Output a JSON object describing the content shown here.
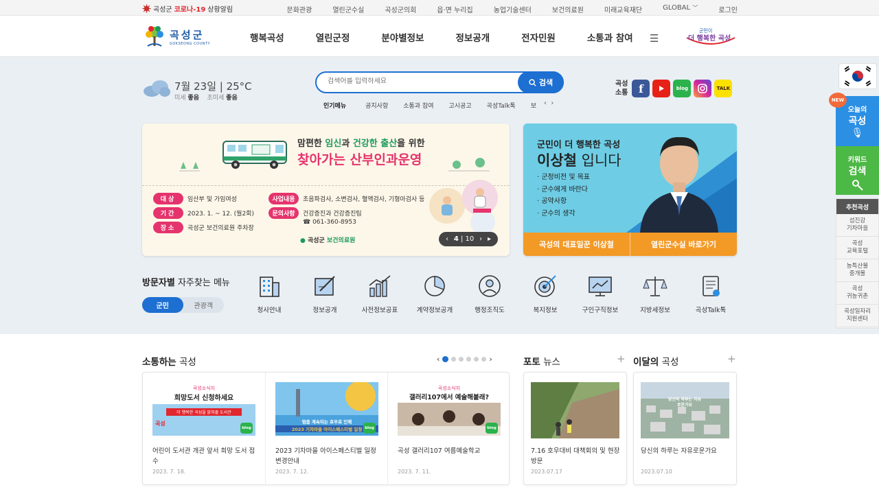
{
  "topbar": {
    "covid_prefix": "곡성군",
    "covid_highlight": "코로나-19",
    "covid_suffix": "상황알림",
    "links": [
      "문화관광",
      "열린군수실",
      "곡성군의회",
      "읍·면 누리집",
      "농업기술센터",
      "보건의료원",
      "미래교육재단",
      "GLOBAL",
      "로그인"
    ]
  },
  "header": {
    "logo_name": "곡성군",
    "logo_en": "GOKSEONG COUNTY",
    "nav": [
      "행복곡성",
      "열린군정",
      "분야별정보",
      "정보공개",
      "전자민원",
      "소통과 참여"
    ],
    "slogan_top": "군민이",
    "slogan_main": "더 행복한 곡성"
  },
  "weather": {
    "date": "7월 23일",
    "temp": "25°C",
    "fine_label": "미세",
    "fine_value": "좋음",
    "ultra_label": "초미세",
    "ultra_value": "좋음"
  },
  "search": {
    "placeholder": "검색어를 입력하세요",
    "button": "검색",
    "popular_label": "인기메뉴",
    "popular": [
      "공지사항",
      "소통과 참여",
      "고시공고",
      "곡성Talk톡",
      "보"
    ]
  },
  "sns": {
    "label_top": "곡성",
    "label_bottom": "소통",
    "icons": [
      "facebook-icon",
      "youtube-icon",
      "blog-icon",
      "instagram-icon",
      "kakaotalk-icon"
    ],
    "blog_text": "blog",
    "talk_text": "TALK"
  },
  "banner": {
    "line1_a": "맘편한 ",
    "line1_b": "임신",
    "line1_c": "과 ",
    "line1_d": "건강한 출산",
    "line1_e": "을 위한",
    "line2": "찾아가는 산부인과운영",
    "rows_left": [
      {
        "label": "대상",
        "text": "임산부 및 가임여성"
      },
      {
        "label": "기간",
        "text": "2023. 1. ~ 12. (월2회)"
      },
      {
        "label": "장소",
        "text": "곡성군 보건의료원 주차장"
      }
    ],
    "rows_right": [
      {
        "label": "사업내용",
        "text": "초음파검사, 소변검사, 혈액검사, 기형아검사 등"
      },
      {
        "label": "문의사항",
        "text": "건강증진과 건강증진팀"
      }
    ],
    "phone": "☎ 061-360-8953",
    "credit_a": "곡성군",
    "credit_b": "보건의료원",
    "counter_current": "4",
    "counter_total": "10"
  },
  "mayor": {
    "line1": "군민이 더 행복한 곡성",
    "name": "이상철",
    "suffix": " 입니다",
    "items": [
      "· 군정비전 및 목표",
      "· 군수에게 바란다",
      "· 공약사항",
      "· 군수의 생각"
    ],
    "btn1": "곡성의 대표일꾼 이상철",
    "btn2": "열린군수실 바로가기"
  },
  "visitor": {
    "title_bold": "방문자별",
    "title_rest": " 자주찾는 메뉴",
    "toggle": [
      "군민",
      "관광객"
    ],
    "items": [
      "청사안내",
      "정보공개",
      "사전정보공표",
      "계약정보공개",
      "행정조직도",
      "복지정보",
      "구인구직정보",
      "지방세정보",
      "곡성Talk톡"
    ]
  },
  "quick": {
    "new": "NEW",
    "today_line1": "오늘의",
    "today_line2": "곡성",
    "kw_line1": "키워드",
    "kw_line2": "검색",
    "rec_title": "추천곡성",
    "rec_items": [
      "섬진강\n기차마을",
      "곡성\n교육포털",
      "농특산물\n중개몰",
      "곡성\n귀농귀촌",
      "곡성일자리\n지원센터"
    ]
  },
  "bottom": {
    "comm_bold": "소통하는",
    "comm_rest": " 곡성",
    "photo_bold": "포토",
    "photo_rest": " 뉴스",
    "month_bold": "이달의",
    "month_rest": " 곡성",
    "cards": [
      {
        "img_tag": "곡성소식지",
        "img_title": "희망도서 신청하세요",
        "img_sub": "더 행복한 곡성을 밝혀줄 도서관",
        "img_big": "곡성",
        "blog": "blog",
        "title": "어린이 도서관 개관 앞서 희망 도서 접수",
        "date": "2023. 7. 18."
      },
      {
        "img_sub": "멈춤 계속되는 호우로 인해",
        "img_big": "2023 기차마을 아이스페스티벌 일정",
        "blog": "blog",
        "title": "2023 기차마을 아이스페스티벌 일정변경안내",
        "date": "2023. 7. 12."
      },
      {
        "img_tag": "곡성소식지",
        "img_title": "갤러리107에서 예술해볼래?",
        "blog": "blog",
        "title": "곡성 갤러리107 여름예술학교",
        "date": "2023. 7. 11."
      }
    ],
    "photo": {
      "title": "7.16 호우대비 대책회의 및 현장 방문",
      "date": "2023.07.17"
    },
    "month": {
      "img_text": "당신의 하루는 자유로운가요",
      "title": "당신의 하루는 자유로운가요",
      "date": "2023.07.10"
    }
  }
}
